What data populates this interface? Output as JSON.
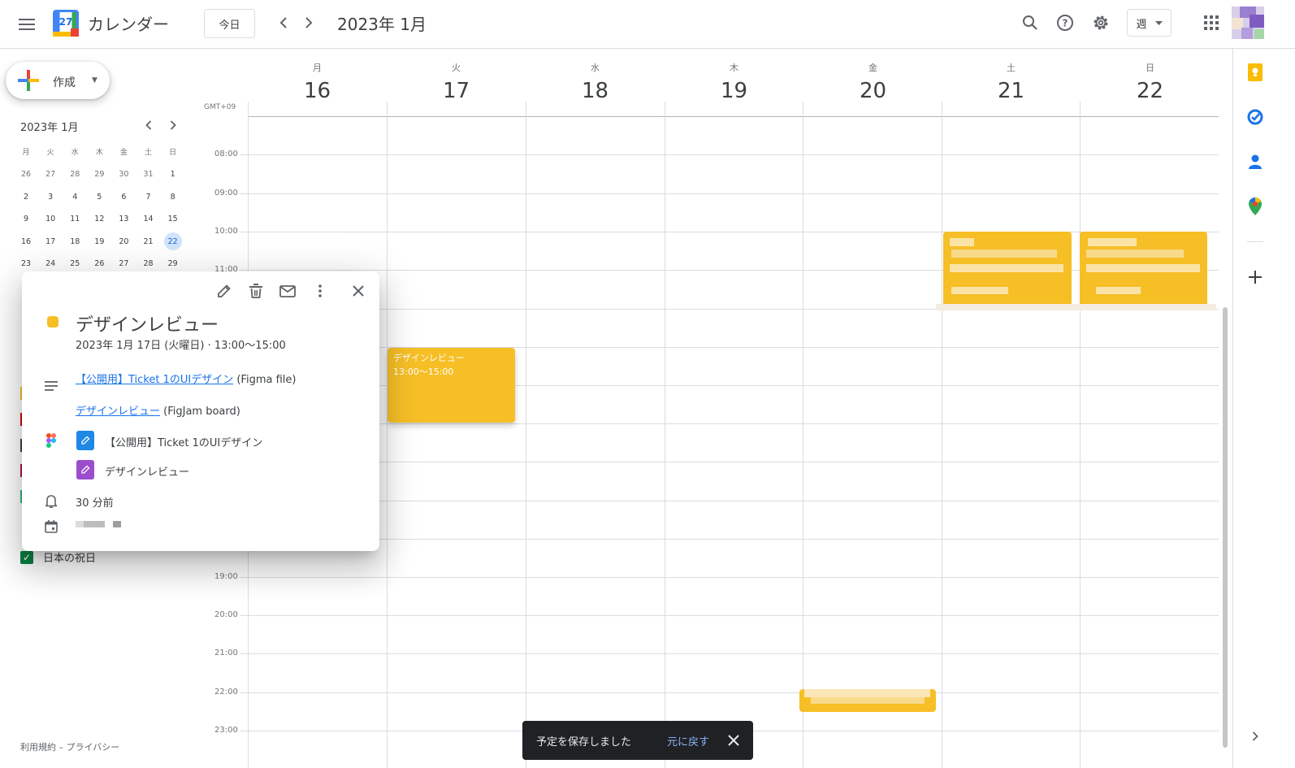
{
  "header": {
    "app_title": "カレンダー",
    "logo_day": "27",
    "today_label": "今日",
    "month_title": "2023年 1月",
    "view_label": "週"
  },
  "sidebar": {
    "create_label": "作成",
    "mini_month": "2023年 1月",
    "weekdays": [
      "月",
      "火",
      "水",
      "木",
      "金",
      "土",
      "日"
    ],
    "weeks": [
      [
        "26",
        "27",
        "28",
        "29",
        "30",
        "31",
        "1"
      ],
      [
        "2",
        "3",
        "4",
        "5",
        "6",
        "7",
        "8"
      ],
      [
        "9",
        "10",
        "11",
        "12",
        "13",
        "14",
        "15"
      ],
      [
        "16",
        "17",
        "18",
        "19",
        "20",
        "21",
        "22"
      ],
      [
        "23",
        "24",
        "25",
        "26",
        "27",
        "28",
        "29"
      ]
    ],
    "selected_day": "22",
    "holiday_calendar_label": "日本の祝日",
    "footer": "利用規約 – プライバシー"
  },
  "grid": {
    "timezone": "GMT+09",
    "days": [
      {
        "weekday": "月",
        "date": "16"
      },
      {
        "weekday": "火",
        "date": "17"
      },
      {
        "weekday": "水",
        "date": "18"
      },
      {
        "weekday": "木",
        "date": "19"
      },
      {
        "weekday": "金",
        "date": "20"
      },
      {
        "weekday": "土",
        "date": "21"
      },
      {
        "weekday": "日",
        "date": "22"
      }
    ],
    "time_labels": [
      "08:00",
      "09:00",
      "10:00",
      "11:00",
      "19:00",
      "20:00",
      "21:00",
      "22:00",
      "23:00"
    ],
    "event": {
      "title": "デザインレビュー",
      "time": "13:00～15:00",
      "color": "#f6bf26"
    }
  },
  "popup": {
    "title": "デザインレビュー",
    "date_line": "2023年 1月 17日 (火曜日)  ·  13:00～15:00",
    "link1_text": "【公開用】Ticket 1のUIデザイン",
    "link1_suffix": " (Figma file)",
    "link2_text": "デザインレビュー",
    "link2_suffix": " (FigJam board)",
    "attachment1": "【公開用】Ticket 1のUIデザイン",
    "attachment2": "デザインレビュー",
    "reminder": "30 分前"
  },
  "snackbar": {
    "message": "予定を保存しました",
    "undo_label": "元に戻す"
  },
  "colors": {
    "event": "#f6bf26",
    "link": "#1a73e8",
    "selected_day_bg": "#d2e3fc",
    "holiday_check": "#0b8043"
  }
}
